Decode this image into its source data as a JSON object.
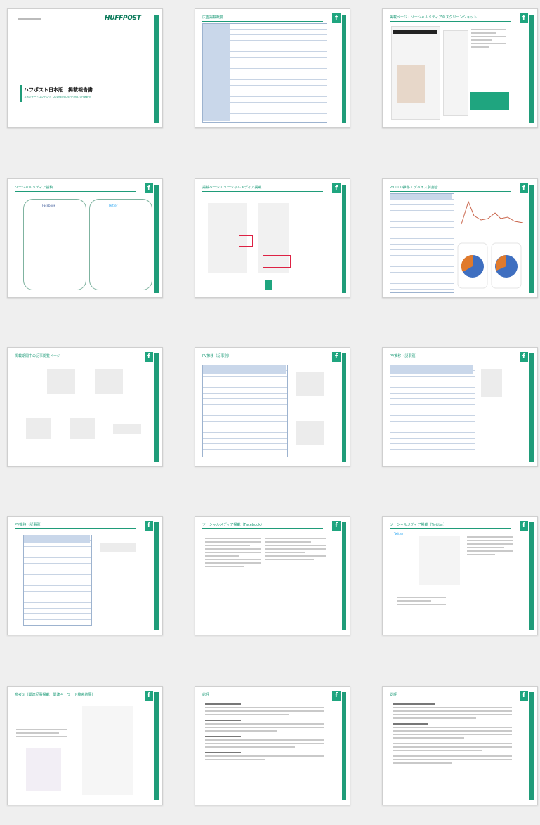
{
  "slides": [
    {
      "id": 1,
      "brand": "HUFFPOST",
      "title": "ハフポスト日本版　掲載報告書",
      "subtitle": "スポンサードコンテンツ　2019年9月26日〜9月27日掲載分"
    },
    {
      "id": 2,
      "title": "広告掲載概要"
    },
    {
      "id": 3,
      "title": "掲載ページ・ソーシャルメディアのスクリーンショット"
    },
    {
      "id": 4,
      "title": "ソーシャルメディア投稿",
      "panels": [
        "Facebook",
        "Twitter"
      ]
    },
    {
      "id": 5,
      "title": "掲載ページ・ソーシャルメディア掲載"
    },
    {
      "id": 6,
      "title": "PV・UU推移・デバイス別割合"
    },
    {
      "id": 7,
      "title": "掲載期間中の記事閲覧ページ"
    },
    {
      "id": 8,
      "title": "PV推移（記事別）"
    },
    {
      "id": 9,
      "title": "PV推移（記事別）"
    },
    {
      "id": 10,
      "title": "PV推移（記事別）"
    },
    {
      "id": 11,
      "title": "ソーシャルメディア掲載（Facebook）"
    },
    {
      "id": 12,
      "title": "ソーシャルメディア掲載（Twitter）",
      "panels": [
        "Twitter"
      ]
    },
    {
      "id": 13,
      "title": "参考①（関連記事掲載　関連キーワード検索結果）"
    },
    {
      "id": 14,
      "title": "総評"
    },
    {
      "id": 15,
      "title": "総評"
    }
  ]
}
